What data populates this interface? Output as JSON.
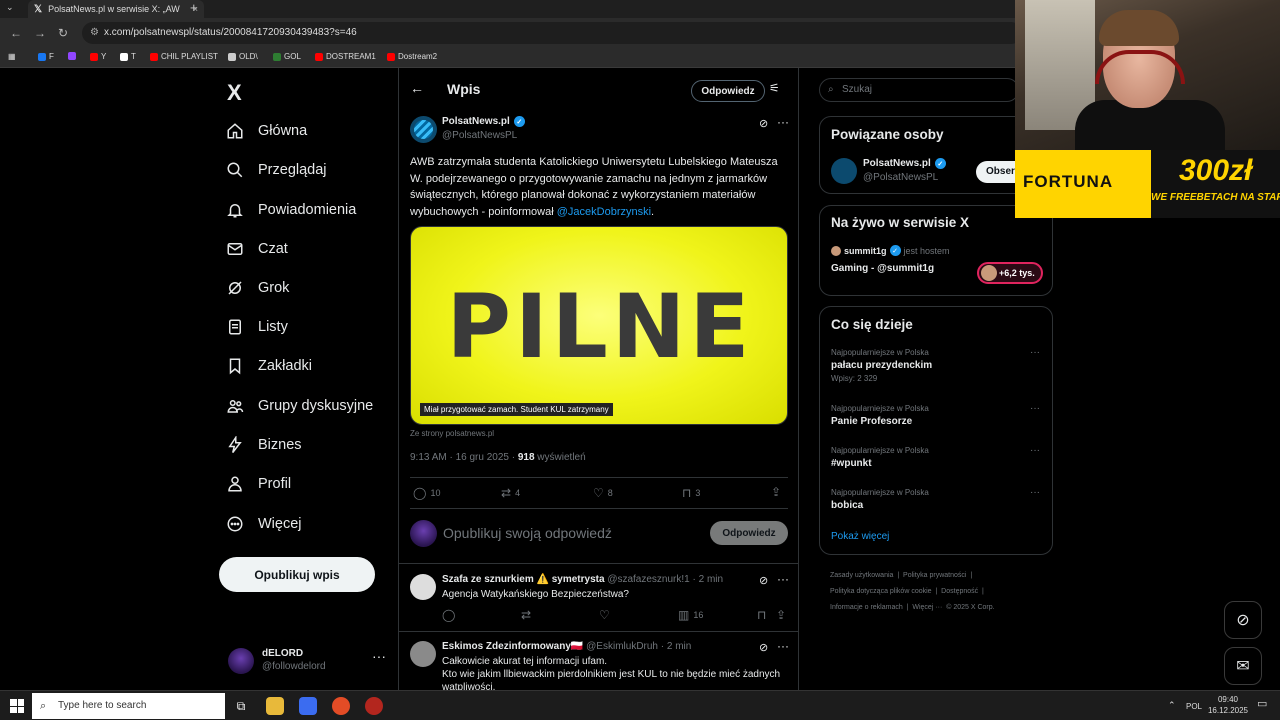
{
  "browser": {
    "tab_title": "PolsatNews.pl w serwisie X: „AW",
    "tab_close": "×",
    "new_tab": "+",
    "url": "x.com/polsatnewspl/status/2000841720930439483?s=46",
    "bookmarks": [
      {
        "label": "F",
        "color": "#1877f2"
      },
      {
        "label": "",
        "color": "#9146ff"
      },
      {
        "label": "Y",
        "color": "#ff0000"
      },
      {
        "label": "T",
        "color": "#ffffff"
      },
      {
        "label": "CHIL PLAYLIST",
        "color": "#ff0000"
      },
      {
        "label": "OLD\\",
        "color": "#cccccc"
      },
      {
        "label": "GOL",
        "color": "#2e7d32"
      },
      {
        "label": "DOSTREAM1",
        "color": "#ff0000"
      },
      {
        "label": "Dostream2",
        "color": "#ff0000"
      }
    ]
  },
  "nav": {
    "logo": "X",
    "items": [
      {
        "label": "Główna",
        "icon": "home-icon"
      },
      {
        "label": "Przeglądaj",
        "icon": "search-icon"
      },
      {
        "label": "Powiadomienia",
        "icon": "bell-icon"
      },
      {
        "label": "Czat",
        "icon": "mail-icon"
      },
      {
        "label": "Grok",
        "icon": "grok-icon"
      },
      {
        "label": "Listy",
        "icon": "list-icon"
      },
      {
        "label": "Zakładki",
        "icon": "bookmark-icon"
      },
      {
        "label": "Grupy dyskusyjne",
        "icon": "people-icon"
      },
      {
        "label": "Biznes",
        "icon": "lightning-icon"
      },
      {
        "label": "Profil",
        "icon": "person-icon"
      },
      {
        "label": "Więcej",
        "icon": "more-circle-icon"
      }
    ],
    "post_button": "Opublikuj wpis",
    "account": {
      "name": "dELORD",
      "handle": "@followdelord"
    }
  },
  "post_header": {
    "title": "Wpis",
    "reply_button": "Odpowiedz"
  },
  "post": {
    "author": "PolsatNews.pl",
    "handle": "@PolsatNewsPL",
    "text_before": "AWB zatrzymała studenta Katolickiego Uniwersytetu Lubelskiego Mateusza W. podejrzewanego o przygotowywanie zamachu na jednym z jarmarków świątecznych, którego planował dokonać z wykorzystaniem materiałów wybuchowych - poinformował ",
    "mention": "@JacekDobrzynski",
    "text_after": ".",
    "media_word": "PILNE",
    "media_caption": "Miał przygotować zamach. Student KUL zatrzymany",
    "source": "Ze strony polsatnews.pl",
    "time": "9:13 AM · 16 gru 2025 · ",
    "views_count": "918",
    "views_label": " wyświetleń",
    "replies": "10",
    "reposts": "4",
    "likes": "8",
    "bookmarks": "3"
  },
  "compose": {
    "placeholder": "Opublikuj swoją odpowiedź",
    "button": "Odpowiedz"
  },
  "replies": [
    {
      "name": "Szafa ze sznurkiem ⚠️ symetrysta",
      "handle": "@szafazesznurk!1 · 2 min",
      "text": "Agencja Watykańskiego Bezpieczeństwa?",
      "views": "16"
    },
    {
      "name": "Eskimos Zdezinformowany🇵🇱",
      "handle": "@EskimlukDruh · 2 min",
      "text": "Całkowicie akurat tej informacji ufam.\nKto wie jakim llbiewackim pierdolnikiem jest KUL to nie będzie mieć żadnych wątpliwości."
    }
  ],
  "right": {
    "search_placeholder": "Szukaj",
    "related": {
      "title": "Powiązane osoby",
      "name": "PolsatNews.pl",
      "handle": "@PolsatNewsPL",
      "follow": "Obser"
    },
    "live": {
      "title": "Na żywo w serwisie X",
      "host": "summit1g",
      "host_suffix": "jest hostem",
      "space": "Gaming - @summit1g",
      "listeners": "+6,2 tys."
    },
    "trends": {
      "title": "Co się dzieje",
      "items": [
        {
          "category": "Najpopularniejsze w Polska",
          "name": "pałacu prezydenckim",
          "posts": "Wpisy: 2 329"
        },
        {
          "category": "Najpopularniejsze w Polska",
          "name": "Panie Profesorze",
          "posts": ""
        },
        {
          "category": "Najpopularniejsze w Polska",
          "name": "#wpunkt",
          "posts": ""
        },
        {
          "category": "Najpopularniejsze w Polska",
          "name": "bobica",
          "posts": ""
        }
      ],
      "show_more": "Pokaż więcej"
    },
    "footer": [
      "Zasady użytkowania",
      "|",
      "Polityka prywatności",
      "|",
      "Polityka dotycząca plików cookie",
      "|",
      "Dostępność",
      "|",
      "Informacje o reklamach",
      "|",
      "Więcej ···",
      "© 2025 X Corp."
    ]
  },
  "overlay": {
    "brand": "FORTUNA",
    "amount": "300zł",
    "promo": "WE FREEBETACH NA START"
  },
  "taskbar": {
    "search_placeholder": "Type here to search",
    "lang": "POL",
    "time": "09:40",
    "date": "16.12.2025"
  }
}
